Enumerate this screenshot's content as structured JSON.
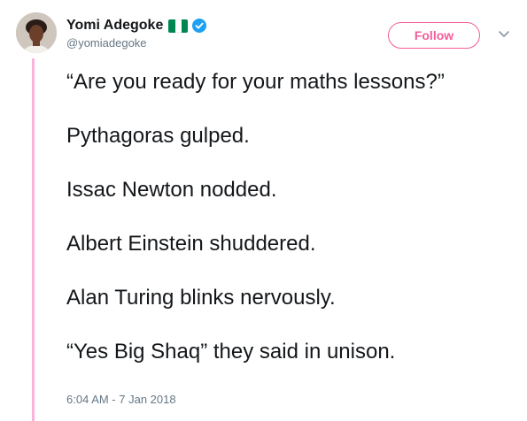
{
  "author": {
    "display_name": "Yomi Adegoke",
    "handle": "@yomiadegoke",
    "verified": true,
    "flag": "nigeria-flag-icon"
  },
  "actions": {
    "follow_label": "Follow",
    "more_icon": "chevron-down-icon"
  },
  "tweet": {
    "lines": [
      "“Are you ready for your maths lessons?”",
      "Pythagoras gulped.",
      "Issac Newton nodded.",
      "Albert Einstein shuddered.",
      "Alan Turing blinks nervously.",
      "“Yes Big Shaq” they said in unison."
    ],
    "timestamp": "6:04 AM - 7 Jan 2018"
  },
  "colors": {
    "accent": "#f45d99",
    "thread_line": "#f9b4dc",
    "verified_blue": "#1da1f2",
    "text": "#14171a",
    "secondary_text": "#657786",
    "flag_green": "#008751"
  }
}
